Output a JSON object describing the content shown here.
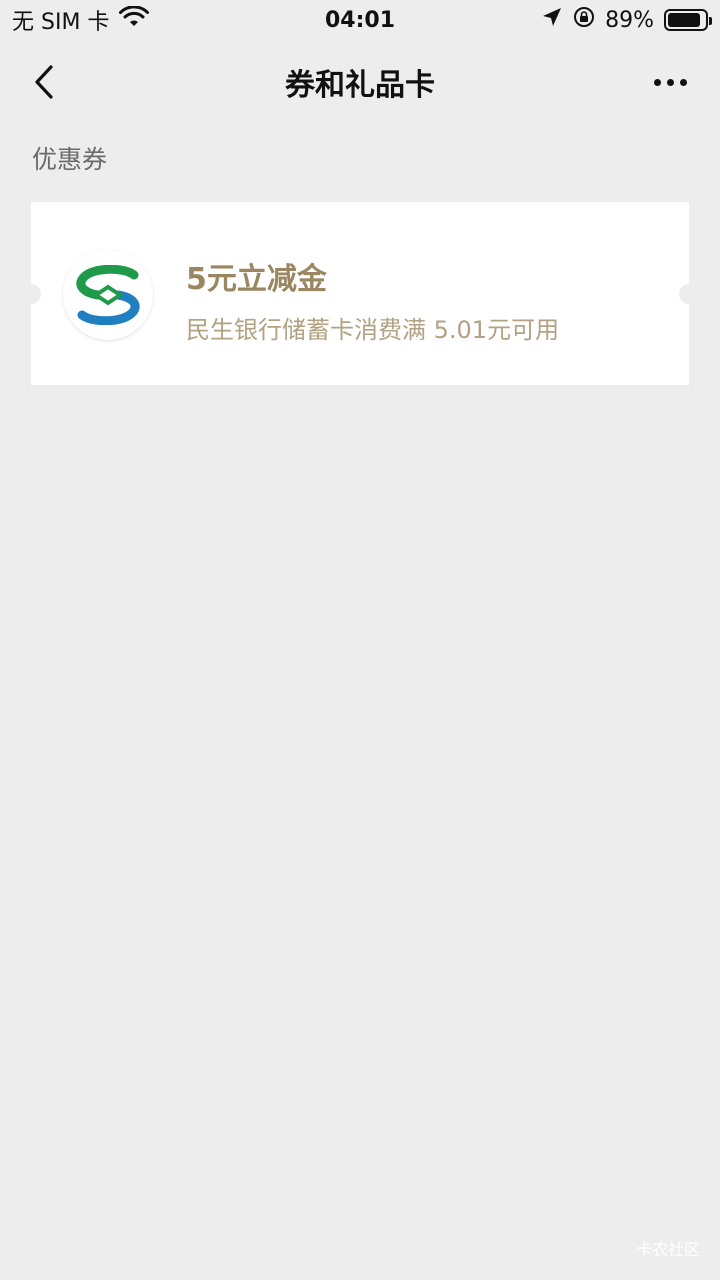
{
  "status_bar": {
    "carrier": "无 SIM 卡",
    "time": "04:01",
    "battery": "89%",
    "battery_level": 0.89
  },
  "nav": {
    "title": "券和礼品卡"
  },
  "section": {
    "label": "优惠券"
  },
  "coupon": {
    "title": "5元立减金",
    "description": "民生银行储蓄卡消费满 5.01元可用"
  },
  "watermark": "卡农社区",
  "colors": {
    "background": "#ededed",
    "card": "#ffffff",
    "coupon_title": "#9a8660",
    "coupon_desc": "#b2a282",
    "logo_green": "#1e9a4a",
    "logo_blue": "#1f7fc0"
  },
  "icons": {
    "wifi": "wifi-icon",
    "location": "location-arrow-icon",
    "rotation_lock": "rotation-lock-icon",
    "battery": "battery-icon",
    "back": "chevron-left-icon",
    "more": "more-dots-icon",
    "logo": "bank-logo"
  }
}
